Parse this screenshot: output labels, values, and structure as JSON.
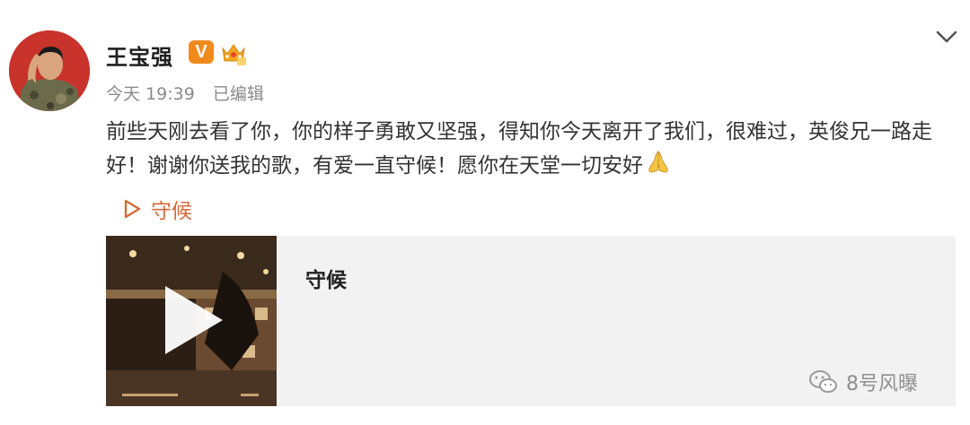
{
  "post": {
    "username": "王宝强",
    "vip_badge": "V",
    "time": "今天 19:39",
    "edited": "已编辑",
    "text": "前些天刚去看了你，你的样子勇敢又坚强，得知你今天离开了我们，很难过，英俊兄一路走好！谢谢你送我的歌，有爱一直守候！愿你在天堂一切安好",
    "emoji": "pray-hands-icon",
    "song_link": "守候"
  },
  "card": {
    "title": "守候"
  },
  "watermark": {
    "text": "8号风曝"
  },
  "colors": {
    "link": "#d46a3b",
    "avatar_bg": "#c8332b",
    "vip": "#f08a1c",
    "card_bg": "#f2f2f2"
  }
}
